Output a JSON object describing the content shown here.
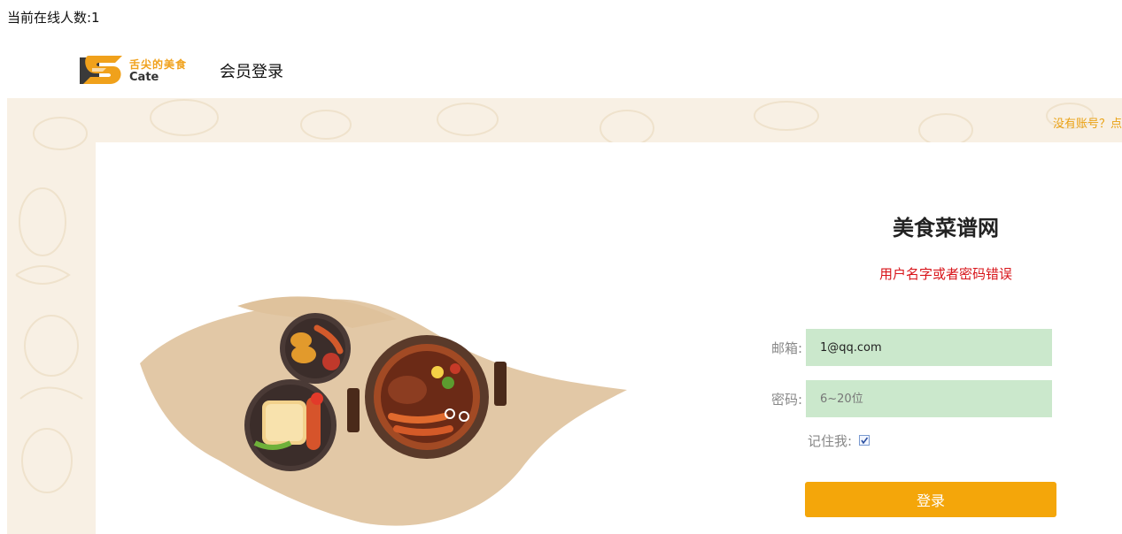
{
  "online": {
    "text": "当前在线人数:1"
  },
  "logo": {
    "cn_text": "舌尖的美食",
    "en_text": "Cate"
  },
  "header": {
    "title": "会员登录"
  },
  "register_link": "没有账号？点",
  "login_form": {
    "site_title": "美食菜谱网",
    "error_message": "用户名字或者密码错误",
    "email_label": "邮箱:",
    "email_value": "1@qq.com",
    "password_label": "密码:",
    "password_placeholder": "6~20位",
    "remember_label": "记住我:",
    "remember_checked": true,
    "submit_label": "登录"
  },
  "colors": {
    "accent": "#f4a60a",
    "error": "#d8141a",
    "field_bg": "#cbe8cc",
    "page_bg": "#f8f0e4"
  },
  "icons": {
    "logo": "cate-logo-icon",
    "illustration": "bbq-food-illustration"
  }
}
